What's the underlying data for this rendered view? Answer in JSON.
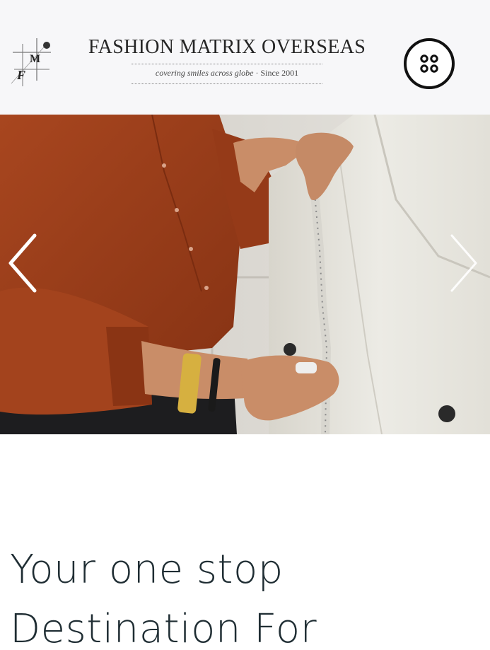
{
  "header": {
    "logo_letters": "MF",
    "brand_name": "FASHION MATRIX OVERSEAS",
    "tagline_script": "covering smiles across globe",
    "tagline_since": "Since 2001"
  },
  "carousel": {
    "prev_icon": "chevron-left-icon",
    "next_icon": "chevron-right-icon"
  },
  "hero_text": {
    "line1": "Your one stop",
    "line2": "Destination For"
  },
  "colors": {
    "header_bg": "#f7f7f9",
    "shirt_rust": "#9e3d1a",
    "coat_cream": "#e9e7df",
    "headline": "#1f2d33"
  }
}
